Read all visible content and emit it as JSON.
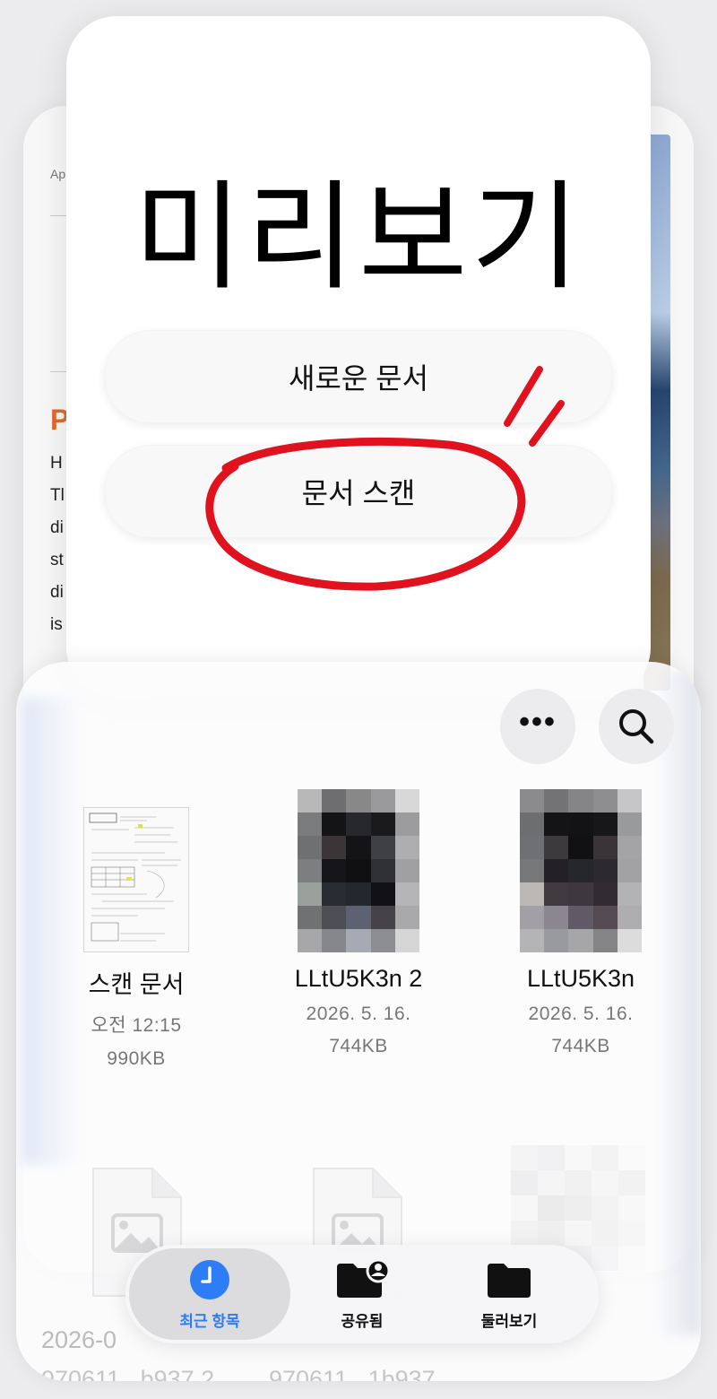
{
  "background_document": {
    "tag": "Ap",
    "headline_letter": "P",
    "text_fragments": [
      "H",
      "Tl",
      "di",
      "st",
      "di",
      "is"
    ]
  },
  "preview": {
    "title": "미리보기",
    "new_document_label": "새로운 문서",
    "scan_document_label": "문서 스캔",
    "annotation_color": "#e0121e"
  },
  "files": {
    "items": [
      {
        "name": "스캔 문서",
        "date": "오전 12:15",
        "size": "990KB",
        "thumb": "scanned-doc"
      },
      {
        "name": "LLtU5K3n 2",
        "date": "2026. 5. 16.",
        "size": "744KB",
        "thumb": "pixelated-image"
      },
      {
        "name": "LLtU5K3n",
        "date": "2026. 5. 16.",
        "size": "744KB",
        "thumb": "pixelated-image"
      }
    ],
    "faded_items": [
      {
        "date": "2026-0",
        "name": "970611...b937 2"
      },
      {
        "date": "",
        "name": "970611...1b937"
      }
    ]
  },
  "tabbar": {
    "tabs": [
      {
        "label": "최근 항목",
        "icon": "clock-icon",
        "active": true
      },
      {
        "label": "공유됨",
        "icon": "shared-folder-icon",
        "active": false
      },
      {
        "label": "둘러보기",
        "icon": "folder-icon",
        "active": false
      }
    ],
    "active_color": "#2f7df6"
  }
}
